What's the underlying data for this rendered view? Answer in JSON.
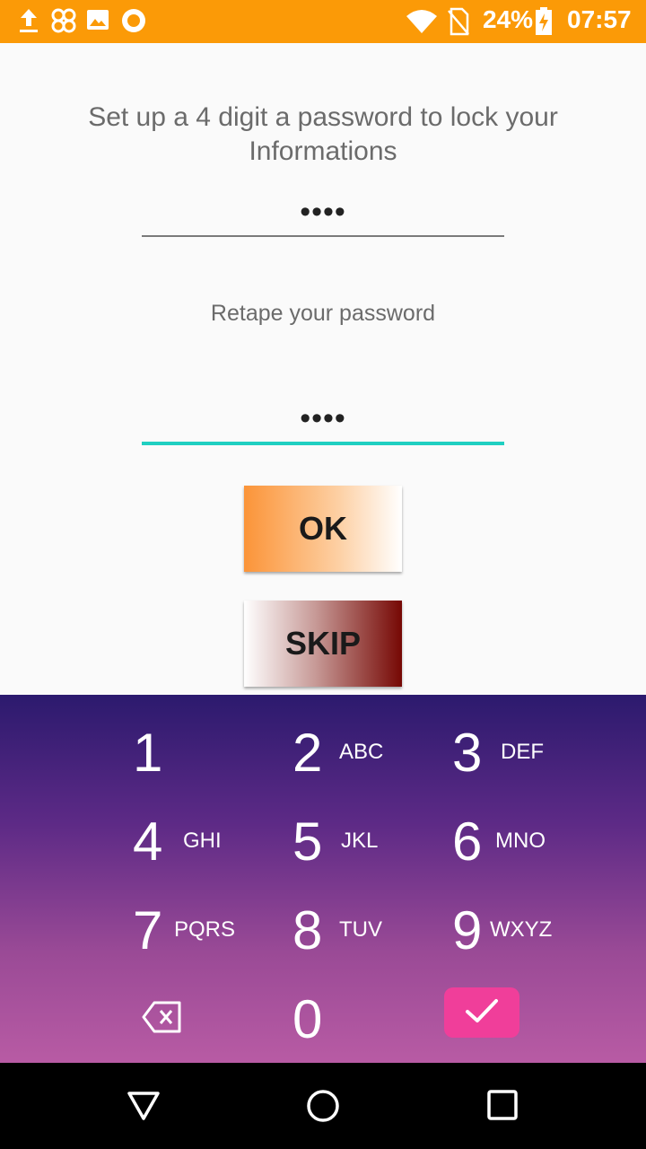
{
  "status_bar": {
    "battery": "24%",
    "time": "07:57",
    "icons": [
      "upload-icon",
      "pinwheel-icon",
      "image-icon",
      "circle-app-icon",
      "wifi-icon",
      "no-sim-icon",
      "battery-charging-icon"
    ]
  },
  "form": {
    "title": "Set up a 4 digit  a password to lock your Informations",
    "password_mask": "••••",
    "retype_label": "Retape your password",
    "retype_mask": "••••"
  },
  "buttons": {
    "ok_label": "OK",
    "skip_label": "SKIP"
  },
  "keypad": {
    "keys": [
      {
        "digit": "1",
        "letters": ""
      },
      {
        "digit": "2",
        "letters": "ABC"
      },
      {
        "digit": "3",
        "letters": "DEF"
      },
      {
        "digit": "4",
        "letters": "GHI"
      },
      {
        "digit": "5",
        "letters": "JKL"
      },
      {
        "digit": "6",
        "letters": "MNO"
      },
      {
        "digit": "7",
        "letters": "PQRS"
      },
      {
        "digit": "8",
        "letters": "TUV"
      },
      {
        "digit": "9",
        "letters": "WXYZ"
      },
      {
        "digit": "0",
        "letters": ""
      }
    ],
    "colors": {
      "top": "#2c1a6e",
      "bottom": "#b85ba4",
      "confirm": "#f03e9a"
    }
  },
  "nav_bar": {
    "icons": [
      "back-triangle-icon",
      "home-circle-icon",
      "recents-square-icon"
    ]
  },
  "colors": {
    "status_bar": "#fb9a07",
    "field_focus": "#1fcfc1"
  }
}
